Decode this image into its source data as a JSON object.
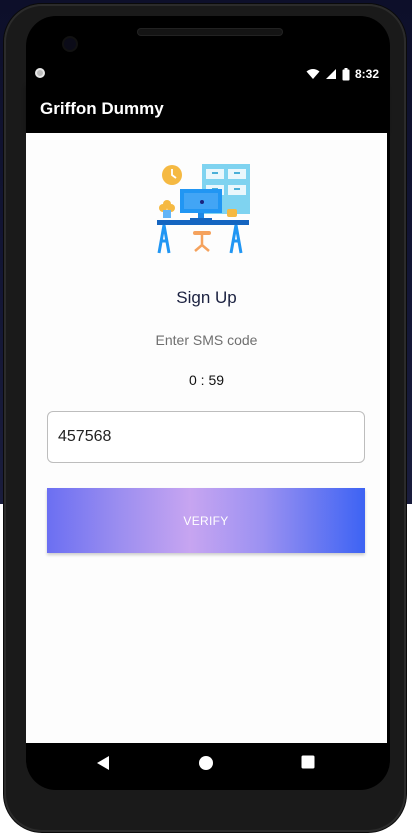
{
  "status_bar": {
    "time": "8:32",
    "icons": [
      "wifi-icon",
      "signal-icon",
      "battery-icon"
    ]
  },
  "app_bar": {
    "title": "Griffon Dummy"
  },
  "signup": {
    "title": "Sign Up",
    "subtitle": "Enter SMS code",
    "timer": "0 : 59",
    "code_value": "457568",
    "verify_label": "VERIFY"
  },
  "nav_bar": {
    "icons": [
      "back-icon",
      "home-icon",
      "recents-icon"
    ]
  },
  "colors": {
    "app_bar_bg": "#000000",
    "content_bg": "#fdfdfd",
    "button_gradient_start": "#6b6ff2",
    "button_gradient_mid": "#c7a5f1",
    "button_gradient_end": "#3d63f3"
  }
}
